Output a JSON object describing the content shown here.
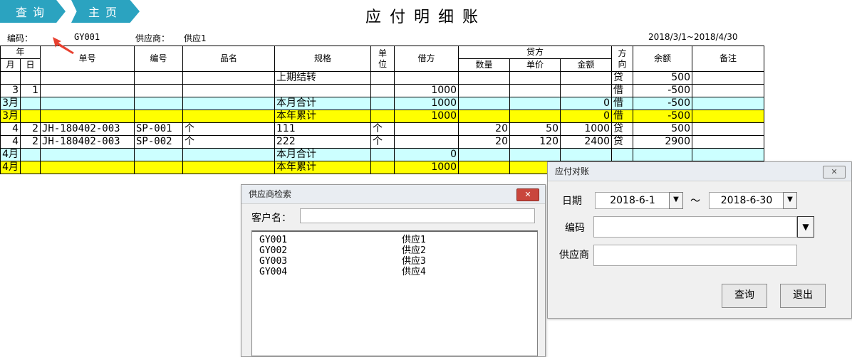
{
  "nav": {
    "query": "查询",
    "home": "主页"
  },
  "title": "应付明细账",
  "meta": {
    "code_label": "编码：",
    "code_value": "GY001",
    "supplier_label": "供应商：",
    "supplier_value": "供应1",
    "date_range": "2018/3/1~2018/4/30"
  },
  "table": {
    "headers": {
      "year": "年",
      "month": "月",
      "day": "日",
      "doc_no": "单号",
      "code": "编号",
      "product": "品名",
      "spec": "规格",
      "unit": "单\n位",
      "debit": "借方",
      "credit": "贷方",
      "qty": "数量",
      "price": "单价",
      "amount": "金额",
      "direction": "方\n向",
      "balance": "余额",
      "note": "备注"
    },
    "rows": [
      {
        "style": "",
        "m": "",
        "d": "",
        "doc": "",
        "code": "",
        "prod": "",
        "spec": "上期结转",
        "unit": "",
        "debit": "",
        "qty": "",
        "price": "",
        "amt": "",
        "dir": "贷",
        "bal": "500",
        "note": ""
      },
      {
        "style": "",
        "m": "3",
        "d": "1",
        "doc": "",
        "code": "",
        "prod": "",
        "spec": "",
        "unit": "",
        "debit": "1000",
        "qty": "",
        "price": "",
        "amt": "",
        "dir": "借",
        "bal": "-500",
        "note": ""
      },
      {
        "style": "cyan",
        "m": "3月",
        "d": "",
        "doc": "",
        "code": "",
        "prod": "",
        "spec": "本月合计",
        "unit": "",
        "debit": "1000",
        "qty": "",
        "price": "",
        "amt": "0",
        "dir": "借",
        "bal": "-500",
        "note": ""
      },
      {
        "style": "yellow",
        "m": "3月",
        "d": "",
        "doc": "",
        "code": "",
        "prod": "",
        "spec": "本年累计",
        "unit": "",
        "debit": "1000",
        "qty": "",
        "price": "",
        "amt": "0",
        "dir": "借",
        "bal": "-500",
        "note": ""
      },
      {
        "style": "",
        "m": "4",
        "d": "2",
        "doc": "JH-180402-003",
        "code": "SP-001",
        "prod": "个",
        "spec": "111",
        "unit": "个",
        "debit": "",
        "qty": "20",
        "price": "50",
        "amt": "1000",
        "dir": "贷",
        "bal": "500",
        "note": ""
      },
      {
        "style": "",
        "m": "4",
        "d": "2",
        "doc": "JH-180402-003",
        "code": "SP-002",
        "prod": "个",
        "spec": "222",
        "unit": "个",
        "debit": "",
        "qty": "20",
        "price": "120",
        "amt": "2400",
        "dir": "贷",
        "bal": "2900",
        "note": ""
      },
      {
        "style": "cyan",
        "m": "4月",
        "d": "",
        "doc": "",
        "code": "",
        "prod": "",
        "spec": "本月合计",
        "unit": "",
        "debit": "0",
        "qty": "",
        "price": "",
        "amt": "",
        "dir": "",
        "bal": "",
        "note": ""
      },
      {
        "style": "yellow",
        "m": "4月",
        "d": "",
        "doc": "",
        "code": "",
        "prod": "",
        "spec": "本年累计",
        "unit": "",
        "debit": "1000",
        "qty": "",
        "price": "",
        "amt": "",
        "dir": "",
        "bal": "",
        "note": ""
      }
    ]
  },
  "supplier_search": {
    "title": "供应商检索",
    "close": "✕",
    "customer_label": "客户名：",
    "customer_value": "",
    "items": [
      {
        "code": "GY001",
        "name": "供应1"
      },
      {
        "code": "GY002",
        "name": "供应2"
      },
      {
        "code": "GY003",
        "name": "供应3"
      },
      {
        "code": "GY004",
        "name": "供应4"
      }
    ]
  },
  "reconcile": {
    "title": "应付对账",
    "close": "✕",
    "date_label": "日期",
    "date_from": "2018-6-1",
    "tilde": "～",
    "date_to": "2018-6-30",
    "code_label": "编码",
    "code_value": "",
    "supplier_label": "供应商",
    "supplier_value": "",
    "dropdown_glyph": "▼",
    "query_btn": "查询",
    "exit_btn": "退出"
  },
  "colors": {
    "nav": "#2ba3c0",
    "cyan_row": "#ccffff",
    "yellow_row": "#ffff00",
    "arrow": "#e8402f"
  }
}
